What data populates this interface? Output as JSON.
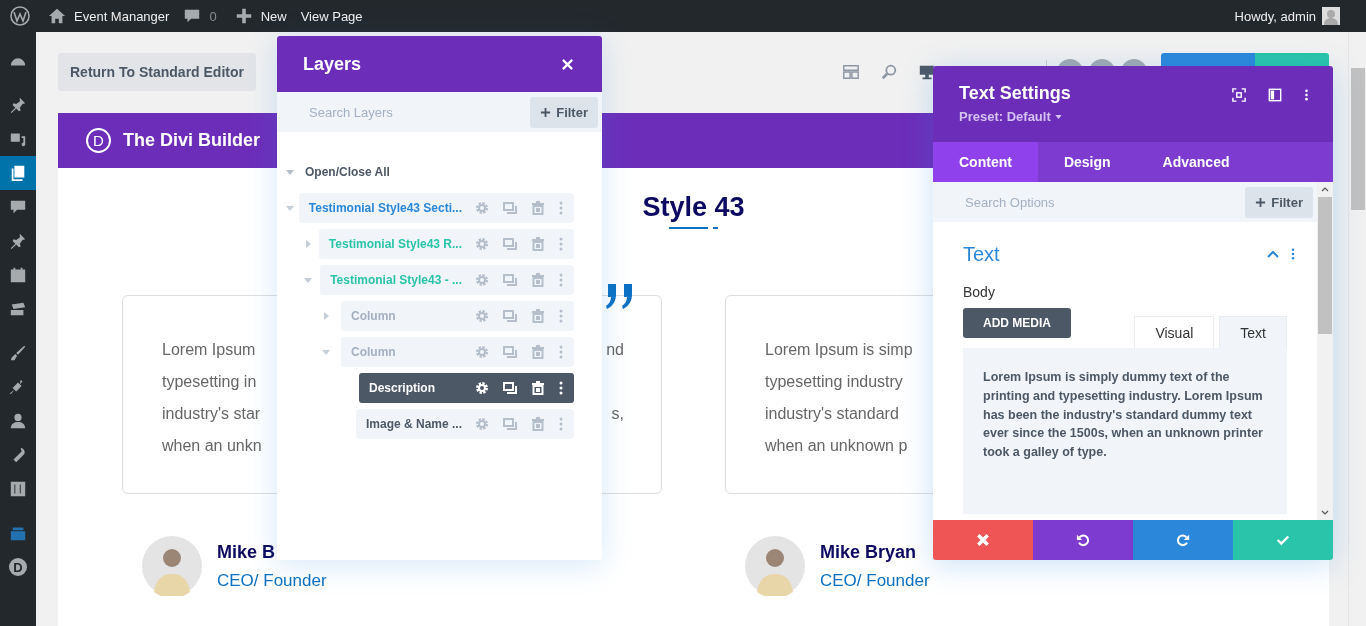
{
  "admin_bar": {
    "site": "Event Mananger",
    "comments": "0",
    "new": "New",
    "view_page": "View Page",
    "greeting": "Howdy, admin"
  },
  "sidebar": {
    "items": [
      {
        "selected": false
      },
      {
        "selected": false
      },
      {
        "selected": false
      },
      {
        "selected": true
      },
      {
        "selected": false
      },
      {
        "selected": false
      },
      {
        "selected": false
      },
      {
        "selected": false
      },
      {
        "selected": false
      },
      {
        "selected": false
      },
      {
        "selected": false
      },
      {
        "selected": false
      },
      {
        "selected": false
      },
      {
        "selected": false
      },
      {
        "selected": false,
        "glyph": "D"
      }
    ]
  },
  "toolbar": {
    "return_button": "Return To Standard Editor"
  },
  "builder": {
    "logo": "D",
    "title": "The Divi Builder"
  },
  "section": {
    "heading": "Style 43",
    "testimonials": [
      {
        "lines": [
          {
            "left": "Lorem Ipsum",
            "right": "nd"
          },
          {
            "left": "typesetting in"
          },
          {
            "left": "industry's star",
            "right": "s,"
          },
          {
            "left": "when an unkn"
          }
        ],
        "name": "Mike B",
        "role": "CEO/ Founder"
      },
      {
        "lines": [
          {
            "left": "Lorem Ipsum is simp"
          },
          {
            "left": "typesetting industry"
          },
          {
            "left": "industry's standard"
          },
          {
            "left": "when an unknown p"
          }
        ],
        "name": "Mike Bryan",
        "role": "CEO/ Founder"
      }
    ]
  },
  "layers": {
    "title": "Layers",
    "search": {
      "placeholder": "Search Layers"
    },
    "filter": "Filter",
    "toggle_all": "Open/Close All",
    "tree": [
      {
        "label": "Testimonial Style43 Secti...",
        "kind": "section",
        "expanded": true,
        "selected": false,
        "children": [
          {
            "label": "Testimonial Style43 R...",
            "kind": "row",
            "expanded": false,
            "selected": false
          },
          {
            "label": "Testimonial Style43 - ...",
            "kind": "row",
            "expanded": true,
            "selected": false,
            "children": [
              {
                "label": "Column",
                "kind": "column",
                "expanded": false,
                "selected": false
              },
              {
                "label": "Column",
                "kind": "column",
                "expanded": true,
                "selected": false,
                "children": [
                  {
                    "label": "Description",
                    "kind": "module",
                    "selected": true
                  },
                  {
                    "label": "Image & Name ...",
                    "kind": "module",
                    "selected": false
                  }
                ]
              }
            ]
          }
        ]
      }
    ]
  },
  "settings": {
    "title": "Text Settings",
    "preset": "Preset: Default",
    "tabs": [
      {
        "label": "Content",
        "selected": true
      },
      {
        "label": "Design",
        "selected": false
      },
      {
        "label": "Advanced",
        "selected": false
      }
    ],
    "search": {
      "placeholder": "Search Options"
    },
    "filter": "Filter",
    "group_title": "Text",
    "field_label": "Body",
    "add_media": "ADD MEDIA",
    "editor_tabs": [
      {
        "label": "Visual",
        "selected": false
      },
      {
        "label": "Text",
        "selected": true
      }
    ],
    "body_text": "Lorem Ipsum is simply dummy text of the printing and typesetting industry. Lorem Ipsum has been the industry's standard dummy text ever since the 1500s, when an unknown printer took a galley of type."
  }
}
